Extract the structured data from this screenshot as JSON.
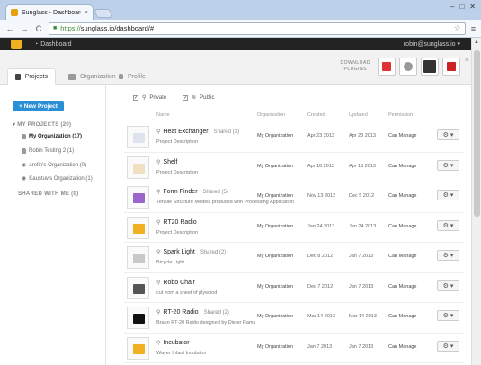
{
  "browser": {
    "tab_title": "Sunglass - Dashboard",
    "tab_close": "×",
    "url_https": "https://",
    "url_rest": "sunglass.io/dashboard/#",
    "back": "←",
    "forward": "→",
    "reload": "C",
    "star": "☆",
    "menu": "≡",
    "win_min": "–",
    "win_max": "□",
    "win_close": "✕"
  },
  "appbar": {
    "dashboard_label": "Dashboard",
    "user": "robin@sunglass.io ▾"
  },
  "tabs": [
    {
      "label": "Projects"
    },
    {
      "label": "Organization"
    },
    {
      "label": "Profile"
    }
  ],
  "plugins": {
    "line1": "DOWNLOAD",
    "line2": "PLUGINS",
    "close": "×"
  },
  "sidebar": {
    "new_project": "+ New Project",
    "my_projects_header": "▾ MY PROJECTS (20)",
    "items": [
      {
        "label": "My Organization (17)"
      },
      {
        "label": "Robin Testing 2 (1)"
      },
      {
        "label": "arefin's Organization (0)"
      },
      {
        "label": "Kaustuv's Organization (1)"
      }
    ],
    "shared_header": "SHARED WITH ME (0)"
  },
  "filters": {
    "private": "Private",
    "public": "Public",
    "check": "✓"
  },
  "columns": {
    "name": "Name",
    "organization": "Organization",
    "created": "Created",
    "updated": "Updated",
    "permission": "Permission"
  },
  "projects": [
    {
      "name": "Heat Exchanger",
      "shared": "Shared (3)",
      "desc": "Project Description",
      "org": "My Organization",
      "created": "Apr 23 2013",
      "updated": "Apr 23 2013",
      "perm": "Can Manage",
      "color": "#dfe3ee"
    },
    {
      "name": "Shelf",
      "shared": "",
      "desc": "Project Description",
      "org": "My Organization",
      "created": "Apr 18 2013",
      "updated": "Apr 18 2013",
      "perm": "Can Manage",
      "color": "#f1dfc1"
    },
    {
      "name": "Form Finder",
      "shared": "Shared (5)",
      "desc": "Tensile Structure Models produced with Processing Application",
      "org": "My Organization",
      "created": "Nov 13 2012",
      "updated": "Dec 5 2012",
      "perm": "Can Manage",
      "color": "#9b66cc"
    },
    {
      "name": "RT20 Radio",
      "shared": "",
      "desc": "Project Description",
      "org": "My Organization",
      "created": "Jan 24 2013",
      "updated": "Jan 24 2013",
      "perm": "Can Manage",
      "color": "#f0b020"
    },
    {
      "name": "Spark Light",
      "shared": "Shared (2)",
      "desc": "Bicycle Light",
      "org": "My Organization",
      "created": "Dec 8 2012",
      "updated": "Jan 7 2013",
      "perm": "Can Manage",
      "color": "#c8c8c8"
    },
    {
      "name": "Robo Chair",
      "shared": "",
      "desc": "cut from a sheet of plywood",
      "org": "My Organization",
      "created": "Dec 7 2012",
      "updated": "Jan 7 2013",
      "perm": "Can Manage",
      "color": "#555555"
    },
    {
      "name": "RT-20 Radio",
      "shared": "Shared (2)",
      "desc": "Braun RT-20 Radio designed by Dieter Rams",
      "org": "My Organization",
      "created": "Mar 14 2013",
      "updated": "Mar 14 2013",
      "perm": "Can Manage",
      "color": "#111111"
    },
    {
      "name": "Incubator",
      "shared": "",
      "desc": "Wayer Infant Incubator",
      "org": "My Organization",
      "created": "Jan 7 2013",
      "updated": "Jan 7 2013",
      "perm": "Can Manage",
      "color": "#f0b020"
    }
  ],
  "row_actions": {
    "gear": "⚙",
    "caret": "▾",
    "pin": "⚲"
  }
}
